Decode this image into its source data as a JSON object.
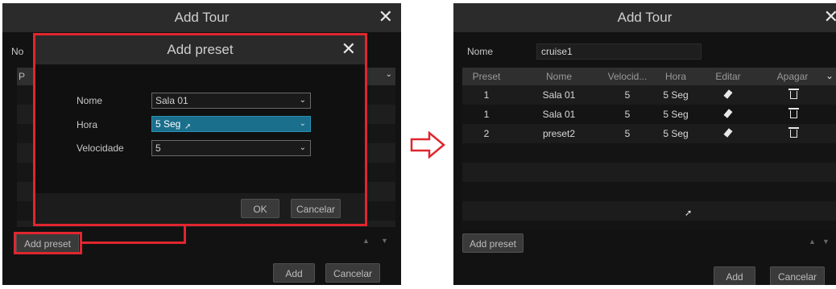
{
  "left": {
    "title": "Add Tour",
    "nome_label_partial": "No",
    "col_partial": "P",
    "add_preset": "Add preset",
    "add": "Add",
    "cancel": "Cancelar"
  },
  "dialog": {
    "title": "Add preset",
    "fields": [
      {
        "label": "Nome",
        "value": "Sala 01"
      },
      {
        "label": "Hora",
        "value": "5 Seg"
      },
      {
        "label": "Velocidade",
        "value": "5"
      }
    ],
    "ok": "OK",
    "cancel": "Cancelar"
  },
  "right": {
    "title": "Add Tour",
    "nome_label": "Nome",
    "nome_value": "cruise1",
    "columns": [
      "Preset",
      "Nome",
      "Velocid...",
      "Hora",
      "Editar",
      "Apagar"
    ],
    "rows": [
      {
        "preset": "1",
        "nome": "Sala 01",
        "vel": "5",
        "hora": "5 Seg"
      },
      {
        "preset": "1",
        "nome": "Sala 01",
        "vel": "5",
        "hora": "5 Seg"
      },
      {
        "preset": "2",
        "nome": "preset2",
        "vel": "5",
        "hora": "5 Seg"
      }
    ],
    "add_preset": "Add preset",
    "add": "Add",
    "cancel": "Cancelar"
  },
  "arrow_color": "#e0262f",
  "accent": "#1a6f8c"
}
